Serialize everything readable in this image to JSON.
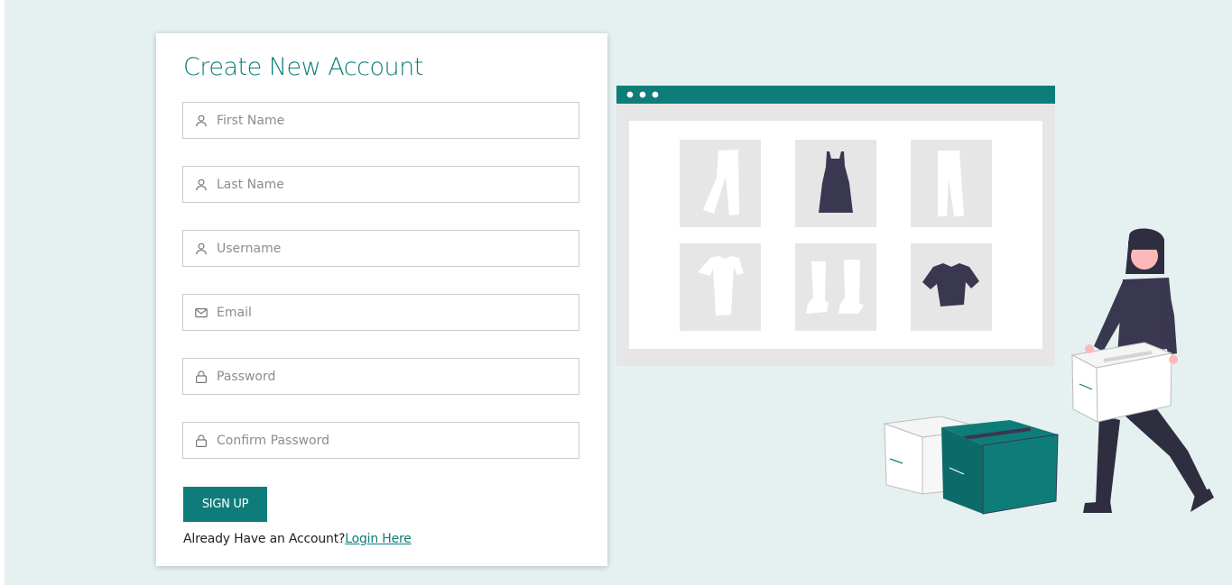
{
  "form": {
    "title": "Create New Account",
    "fields": [
      {
        "placeholder": "First Name",
        "icon": "user-icon",
        "value": ""
      },
      {
        "placeholder": "Last Name",
        "icon": "user-icon",
        "value": ""
      },
      {
        "placeholder": "Username",
        "icon": "user-icon",
        "value": ""
      },
      {
        "placeholder": "Email",
        "icon": "envelope-icon",
        "value": ""
      },
      {
        "placeholder": "Password",
        "icon": "lock-icon",
        "value": ""
      },
      {
        "placeholder": "Confirm Password",
        "icon": "lock-icon",
        "value": ""
      }
    ],
    "submit_label": "SIGN UP",
    "login_prompt": "Already Have an Account?",
    "login_link": "Login Here"
  },
  "colors": {
    "accent": "#0e7d7a",
    "background": "#e4f1f0",
    "card": "#ffffff",
    "dark": "#3a3750"
  }
}
